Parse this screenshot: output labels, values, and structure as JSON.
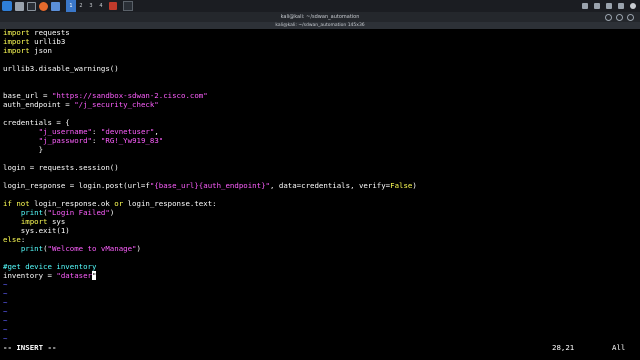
{
  "panel": {
    "workspaces": [
      "1",
      "2",
      "3",
      "4"
    ],
    "active_workspace": "1"
  },
  "window": {
    "title": "kali@kali: ~/sdwan_automation",
    "tab_title": "kali@kali: ~/sdwan_automation 145x36"
  },
  "editor": {
    "lines": [
      [
        {
          "t": "import",
          "c": "kw"
        },
        {
          "t": " requests",
          "c": ""
        }
      ],
      [
        {
          "t": "import",
          "c": "kw"
        },
        {
          "t": " urllib3",
          "c": ""
        }
      ],
      [
        {
          "t": "import",
          "c": "kw"
        },
        {
          "t": " json",
          "c": ""
        }
      ],
      [],
      [
        {
          "t": "urllib3.disable_warnings()",
          "c": ""
        }
      ],
      [],
      [],
      [
        {
          "t": "base_url = ",
          "c": ""
        },
        {
          "t": "\"https://sandbox-sdwan-2.cisco.com\"",
          "c": "str"
        }
      ],
      [
        {
          "t": "auth_endpoint = ",
          "c": ""
        },
        {
          "t": "\"/j_security_check\"",
          "c": "str"
        }
      ],
      [],
      [
        {
          "t": "credentials = {",
          "c": ""
        }
      ],
      [
        {
          "t": "        ",
          "c": ""
        },
        {
          "t": "\"j_username\"",
          "c": "str"
        },
        {
          "t": ": ",
          "c": ""
        },
        {
          "t": "\"devnetuser\"",
          "c": "str"
        },
        {
          "t": ",",
          "c": ""
        }
      ],
      [
        {
          "t": "        ",
          "c": ""
        },
        {
          "t": "\"j_password\"",
          "c": "str"
        },
        {
          "t": ": ",
          "c": ""
        },
        {
          "t": "\"RG!_Yw919_83\"",
          "c": "str"
        }
      ],
      [
        {
          "t": "        }",
          "c": ""
        }
      ],
      [],
      [
        {
          "t": "login = requests.session()",
          "c": ""
        }
      ],
      [],
      [
        {
          "t": "login_response = login.post(url=f",
          "c": ""
        },
        {
          "t": "\"{base_url}{auth_endpoint}\"",
          "c": "str"
        },
        {
          "t": ", data=credentials, verify=",
          "c": ""
        },
        {
          "t": "False",
          "c": "kw"
        },
        {
          "t": ")",
          "c": ""
        }
      ],
      [],
      [
        {
          "t": "if not",
          "c": "kw"
        },
        {
          "t": " login_response.ok ",
          "c": ""
        },
        {
          "t": "or",
          "c": "kw"
        },
        {
          "t": " login_response.text:",
          "c": ""
        }
      ],
      [
        {
          "t": "    ",
          "c": ""
        },
        {
          "t": "print",
          "c": "fn"
        },
        {
          "t": "(",
          "c": ""
        },
        {
          "t": "\"Login Failed\"",
          "c": "str"
        },
        {
          "t": ")",
          "c": ""
        }
      ],
      [
        {
          "t": "    ",
          "c": ""
        },
        {
          "t": "import",
          "c": "kw"
        },
        {
          "t": " sys",
          "c": ""
        }
      ],
      [
        {
          "t": "    sys.exit(1)",
          "c": ""
        }
      ],
      [
        {
          "t": "else",
          "c": "kw"
        },
        {
          "t": ":",
          "c": ""
        }
      ],
      [
        {
          "t": "    ",
          "c": ""
        },
        {
          "t": "print",
          "c": "fn"
        },
        {
          "t": "(",
          "c": ""
        },
        {
          "t": "\"Welcome to vManage\"",
          "c": "str"
        },
        {
          "t": ")",
          "c": ""
        }
      ],
      [],
      [
        {
          "t": "#get device inventory",
          "c": "cmt"
        }
      ],
      [
        {
          "t": "inventory = ",
          "c": ""
        },
        {
          "t": "\"dataser",
          "c": "str"
        },
        {
          "t": "\"",
          "c": "cursor"
        }
      ],
      [
        {
          "t": "~",
          "c": "tilde"
        }
      ],
      [
        {
          "t": "~",
          "c": "tilde"
        }
      ],
      [
        {
          "t": "~",
          "c": "tilde"
        }
      ],
      [
        {
          "t": "~",
          "c": "tilde"
        }
      ],
      [
        {
          "t": "~",
          "c": "tilde"
        }
      ],
      [
        {
          "t": "~",
          "c": "tilde"
        }
      ],
      [
        {
          "t": "~",
          "c": "tilde"
        }
      ]
    ]
  },
  "status": {
    "mode": "-- INSERT --",
    "position": "28,21",
    "percent": "All"
  }
}
